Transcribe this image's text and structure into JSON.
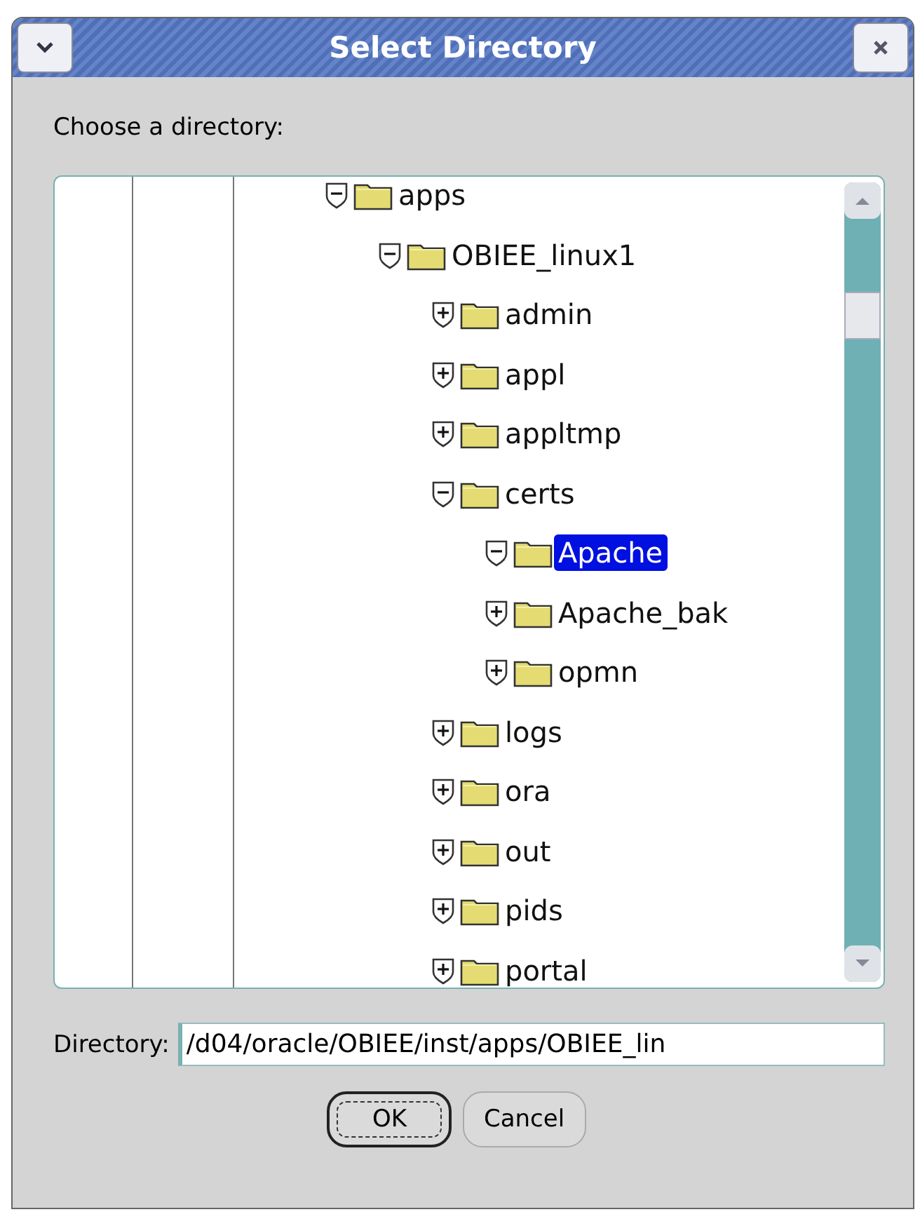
{
  "window": {
    "title": "Select Directory"
  },
  "prompt": "Choose a directory:",
  "tree": [
    {
      "label": "apps",
      "expanded": true,
      "selected": false,
      "children": [
        {
          "label": "OBIEE_linux1",
          "expanded": true,
          "selected": false,
          "children": [
            {
              "label": "admin",
              "expanded": false,
              "selected": false
            },
            {
              "label": "appl",
              "expanded": false,
              "selected": false
            },
            {
              "label": "appltmp",
              "expanded": false,
              "selected": false
            },
            {
              "label": "certs",
              "expanded": true,
              "selected": false,
              "children": [
                {
                  "label": "Apache",
                  "expanded": true,
                  "selected": true
                },
                {
                  "label": "Apache_bak",
                  "expanded": false,
                  "selected": false
                },
                {
                  "label": "opmn",
                  "expanded": false,
                  "selected": false
                }
              ]
            },
            {
              "label": "logs",
              "expanded": false,
              "selected": false
            },
            {
              "label": "ora",
              "expanded": false,
              "selected": false
            },
            {
              "label": "out",
              "expanded": false,
              "selected": false
            },
            {
              "label": "pids",
              "expanded": false,
              "selected": false
            },
            {
              "label": "portal",
              "expanded": false,
              "selected": false
            }
          ]
        }
      ]
    }
  ],
  "directory": {
    "label": "Directory:",
    "value": "/d04/oracle/OBIEE/inst/apps/OBIEE_lin"
  },
  "buttons": [
    {
      "label": "OK",
      "kind": "default"
    },
    {
      "label": "Cancel",
      "kind": "normal"
    }
  ]
}
